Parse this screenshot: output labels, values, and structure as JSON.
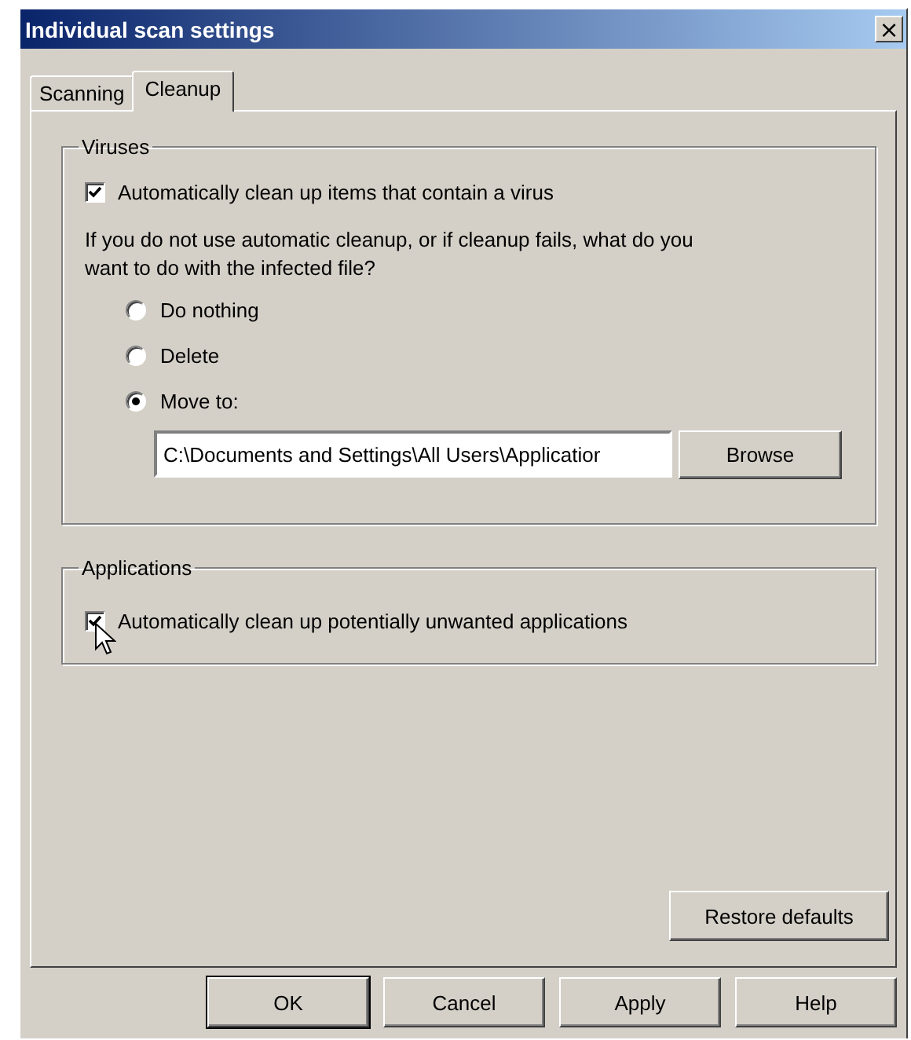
{
  "window": {
    "title": "Individual scan settings",
    "close": "×"
  },
  "tabs": [
    {
      "label": "Scanning",
      "selected": false
    },
    {
      "label": "Cleanup",
      "selected": true
    }
  ],
  "viruses": {
    "title": "Viruses",
    "checkbox": {
      "label": "Automatically clean up items that contain a virus",
      "checked": true
    },
    "prompt": "If you do not use automatic cleanup, or if cleanup fails, what do you want to do with the infected file?",
    "options": [
      {
        "label": "Do nothing",
        "selected": false
      },
      {
        "label": "Delete",
        "selected": false
      },
      {
        "label": "Move to:",
        "selected": true
      }
    ],
    "path": {
      "value": "C:\\Documents and Settings\\All Users\\Applicatior"
    },
    "browse": "Browse"
  },
  "applications": {
    "title": "Applications",
    "checkbox": {
      "label": "Automatically clean up potentially unwanted applications",
      "checked": true
    }
  },
  "restore": "Restore defaults",
  "buttons": [
    {
      "label": "OK",
      "default": true
    },
    {
      "label": "Cancel",
      "default": false
    },
    {
      "label": "Apply",
      "default": false
    },
    {
      "label": "Help",
      "default": false
    }
  ]
}
